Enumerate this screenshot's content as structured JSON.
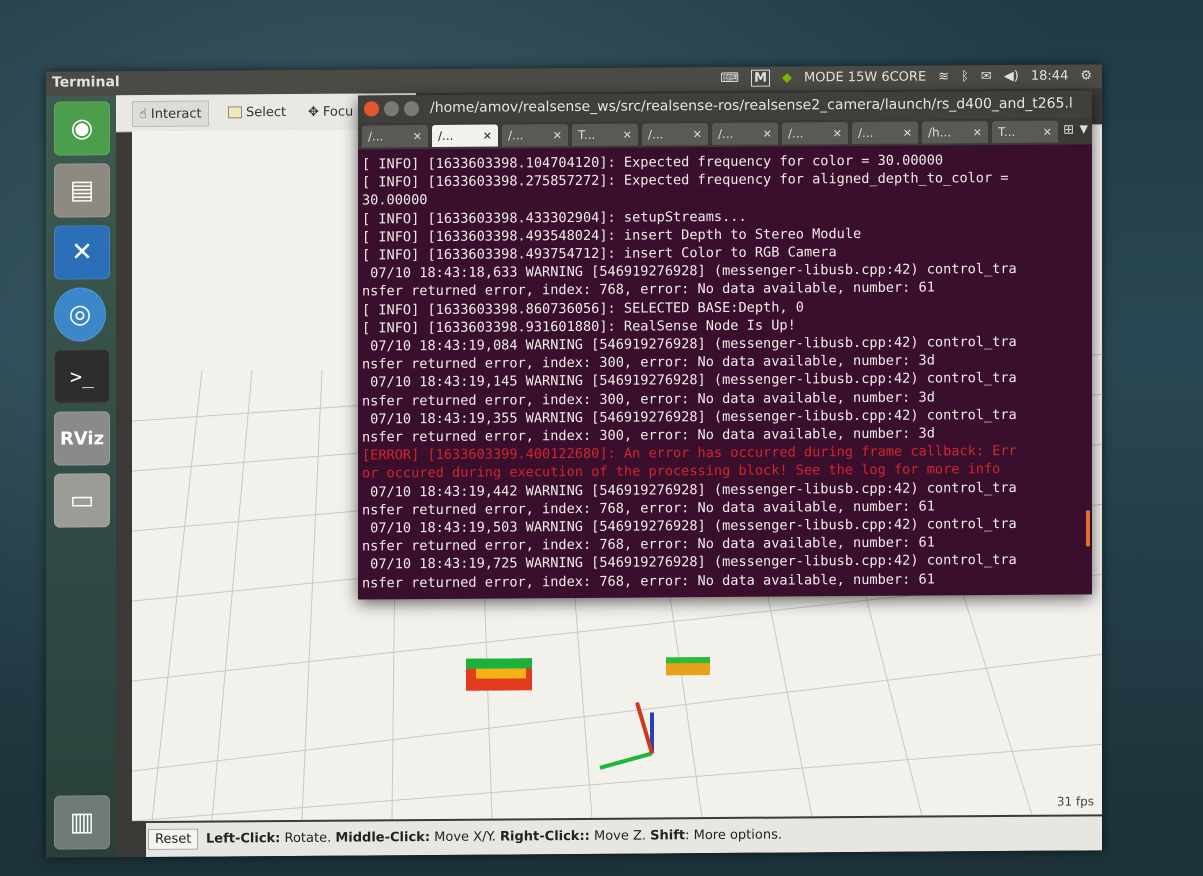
{
  "top_panel": {
    "title": "Terminal",
    "mode": "MODE 15W 6CORE",
    "time": "18:44"
  },
  "rviz": {
    "toolbar": [
      "Interact",
      "Select",
      "Focu"
    ],
    "fps": "31 fps",
    "reset_label": "Reset",
    "hint": {
      "left_key": "Left-Click:",
      "left_val": " Rotate. ",
      "middle_key": "Middle-Click:",
      "middle_val": " Move X/Y. ",
      "right_key": "Right-Click::",
      "right_val": " Move Z. ",
      "shift_key": "Shift",
      "shift_val": ": More options."
    }
  },
  "terminal": {
    "path": "/home/amov/realsense_ws/src/realsense-ros/realsense2_camera/launch/rs_d400_and_t265.l",
    "tabs": [
      "/...",
      "/...",
      "/...",
      "T...",
      "/...",
      "/...",
      "/...",
      "/...",
      "/h...",
      "T..."
    ],
    "active_tab": 1,
    "lines": [
      {
        "text": "[ INFO] [1633603398.104704120]: Expected frequency for color = 30.00000",
        "level": "info"
      },
      {
        "text": "[ INFO] [1633603398.275857272]: Expected frequency for aligned_depth_to_color =",
        "level": "info"
      },
      {
        "text": "30.00000",
        "level": "info"
      },
      {
        "text": "[ INFO] [1633603398.433302904]: setupStreams...",
        "level": "info"
      },
      {
        "text": "[ INFO] [1633603398.493548024]: insert Depth to Stereo Module",
        "level": "info"
      },
      {
        "text": "[ INFO] [1633603398.493754712]: insert Color to RGB Camera",
        "level": "info"
      },
      {
        "text": " 07/10 18:43:18,633 WARNING [546919276928] (messenger-libusb.cpp:42) control_tra",
        "level": "warn"
      },
      {
        "text": "nsfer returned error, index: 768, error: No data available, number: 61",
        "level": "warn"
      },
      {
        "text": "[ INFO] [1633603398.860736056]: SELECTED BASE:Depth, 0",
        "level": "info"
      },
      {
        "text": "[ INFO] [1633603398.931601880]: RealSense Node Is Up!",
        "level": "info"
      },
      {
        "text": " 07/10 18:43:19,084 WARNING [546919276928] (messenger-libusb.cpp:42) control_tra",
        "level": "warn"
      },
      {
        "text": "nsfer returned error, index: 300, error: No data available, number: 3d",
        "level": "warn"
      },
      {
        "text": " 07/10 18:43:19,145 WARNING [546919276928] (messenger-libusb.cpp:42) control_tra",
        "level": "warn"
      },
      {
        "text": "nsfer returned error, index: 300, error: No data available, number: 3d",
        "level": "warn"
      },
      {
        "text": " 07/10 18:43:19,355 WARNING [546919276928] (messenger-libusb.cpp:42) control_tra",
        "level": "warn"
      },
      {
        "text": "nsfer returned error, index: 300, error: No data available, number: 3d",
        "level": "warn"
      },
      {
        "text": "[ERROR] [1633603399.400122680]: An error has occurred during frame callback: Err",
        "level": "error"
      },
      {
        "text": "or occured during execution of the processing block! See the log for more info",
        "level": "error"
      },
      {
        "text": " 07/10 18:43:19,442 WARNING [546919276928] (messenger-libusb.cpp:42) control_tra",
        "level": "warn"
      },
      {
        "text": "nsfer returned error, index: 768, error: No data available, number: 61",
        "level": "warn"
      },
      {
        "text": " 07/10 18:43:19,503 WARNING [546919276928] (messenger-libusb.cpp:42) control_tra",
        "level": "warn"
      },
      {
        "text": "nsfer returned error, index: 768, error: No data available, number: 61",
        "level": "warn"
      },
      {
        "text": " 07/10 18:43:19,725 WARNING [546919276928] (messenger-libusb.cpp:42) control_tra",
        "level": "warn"
      },
      {
        "text": "nsfer returned error, index: 768, error: No data available, number: 61",
        "level": "warn"
      }
    ]
  },
  "launcher": {
    "items": [
      {
        "name": "ubuntu-dash-icon",
        "glyph": "◉"
      },
      {
        "name": "files-icon",
        "glyph": "▤"
      },
      {
        "name": "vscode-icon",
        "glyph": "✕"
      },
      {
        "name": "chromium-icon",
        "glyph": "◎"
      },
      {
        "name": "terminal-icon",
        "glyph": ">_"
      },
      {
        "name": "rviz-icon",
        "glyph": "RViz"
      },
      {
        "name": "drive-icon",
        "glyph": "▭"
      }
    ],
    "trash_glyph": "🗑"
  },
  "colors": {
    "terminal_bg": "#3a0f2e",
    "error": "#d0262a",
    "nvidia": "#76b900"
  }
}
